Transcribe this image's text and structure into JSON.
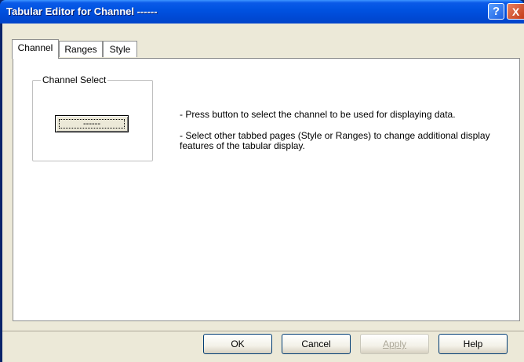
{
  "window": {
    "title": "Tabular Editor for Channel ------",
    "help_glyph": "?",
    "close_glyph": "X"
  },
  "tabs": [
    {
      "label": "Channel",
      "active": true
    },
    {
      "label": "Ranges",
      "active": false
    },
    {
      "label": "Style",
      "active": false
    }
  ],
  "channel_group": {
    "label": "Channel Select",
    "button_label": "------"
  },
  "instructions": [
    "- Press button to select the channel to be used for displaying data.",
    "- Select other tabbed pages (Style or Ranges) to change additional display features of the tabular display."
  ],
  "buttons": {
    "ok": "OK",
    "cancel": "Cancel",
    "apply": "Apply",
    "help": "Help"
  }
}
